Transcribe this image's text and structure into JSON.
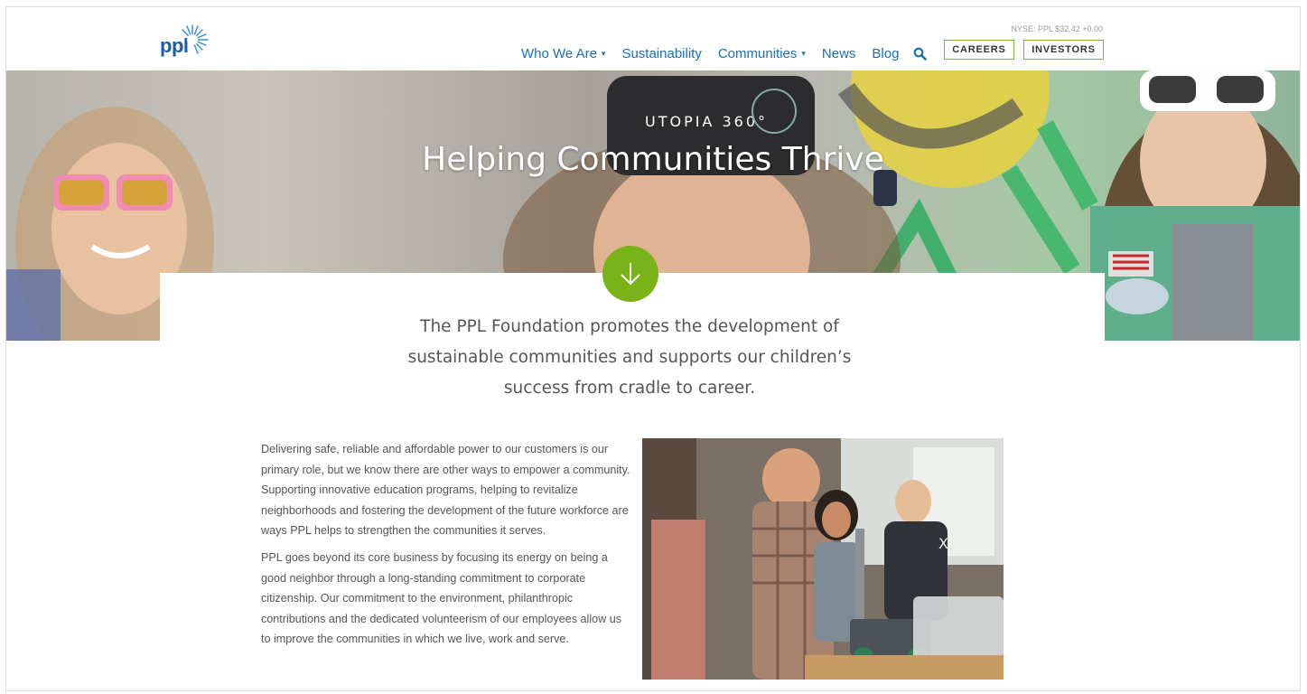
{
  "header": {
    "logo_text": "ppl",
    "stock": "NYSE: PPL $32.42 +0.00",
    "nav": [
      {
        "label": "Who We Are",
        "dropdown": true
      },
      {
        "label": "Sustainability",
        "dropdown": false
      },
      {
        "label": "Communities",
        "dropdown": true
      },
      {
        "label": "News",
        "dropdown": false
      },
      {
        "label": "Blog",
        "dropdown": false
      }
    ],
    "careers_label": "CAREERS",
    "investors_label": "INVESTORS"
  },
  "hero": {
    "title": "Helping Communities Thrive",
    "headset_brand": "UTOPIA 360°"
  },
  "intro": "The PPL Foundation promotes the development of sustainable communities and supports our children’s success from cradle to career.",
  "body": {
    "p1": "Delivering safe, reliable and affordable power to our customers is our primary role, but we know there are other ways to empower a community. Supporting innovative education programs, helping to revitalize neighborhoods and fostering the development of the future workforce are ways PPL helps to strengthen the communities it serves.",
    "p2": "PPL goes beyond its core business by focusing its energy on being a good neighbor through a long-standing commitment to corporate citizenship. Our commitment to the environment, philanthropic contributions and the dedicated volunteerism of our employees allow us to improve the communities in which we live, work and serve."
  },
  "icons": {
    "search": "search-icon",
    "down_arrow": "arrow-down-icon",
    "caret": "chevron-down-icon"
  },
  "colors": {
    "nav_blue": "#1d6fb0",
    "accent_green": "#7ab317",
    "button_border": "#7cb342"
  }
}
